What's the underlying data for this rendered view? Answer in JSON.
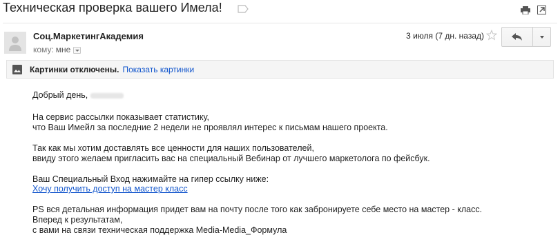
{
  "message": {
    "subject": "Техническая проверка вашего Имела!",
    "sender_name": "Соц.МаркетингАкадемия",
    "recipient_label": "кому:",
    "recipient_value": "мне",
    "date": "3 июля (7 дн. назад)"
  },
  "images_notice": {
    "text": "Картинки отключены.",
    "link": "Показать картинки"
  },
  "body": {
    "greeting": "Добрый день,",
    "paragraph1_line1": "На сервис рассылки показывает статистику,",
    "paragraph1_line2": "что Ваш Имейл за последние 2 недели не проявлял интерес к письмам нашего проекта.",
    "paragraph2_line1": "Так как мы хотим доставлять все ценности для наших пользователей,",
    "paragraph2_line2": "ввиду этого желаем пригласить вас на специальный Вебинар от лучшего маркетолога по фейсбук.",
    "paragraph3_line1": "Ваш Специальный Вход нажимайте на гипер ссылку ниже:",
    "link_text": "Хочу получить доступ на мастер класс",
    "ps_line1": "PS вся детальная информация придет вам на почту после того как забронируете себе место на мастер - класс.",
    "ps_line2": "Вперед к результатам,",
    "ps_line3": "с вами на связи техническая поддержка Media-Media_Формула"
  },
  "icons": {
    "label": "label-tag-icon",
    "print": "print-icon",
    "popout": "new-window-icon",
    "star": "star-icon",
    "reply": "reply-arrow-icon",
    "more": "chevron-down-icon",
    "avatar": "person-silhouette-icon",
    "images": "image-icon"
  },
  "colors": {
    "link": "#1155cc",
    "images_bar_bg": "#f5f5f5",
    "text": "#222222"
  }
}
